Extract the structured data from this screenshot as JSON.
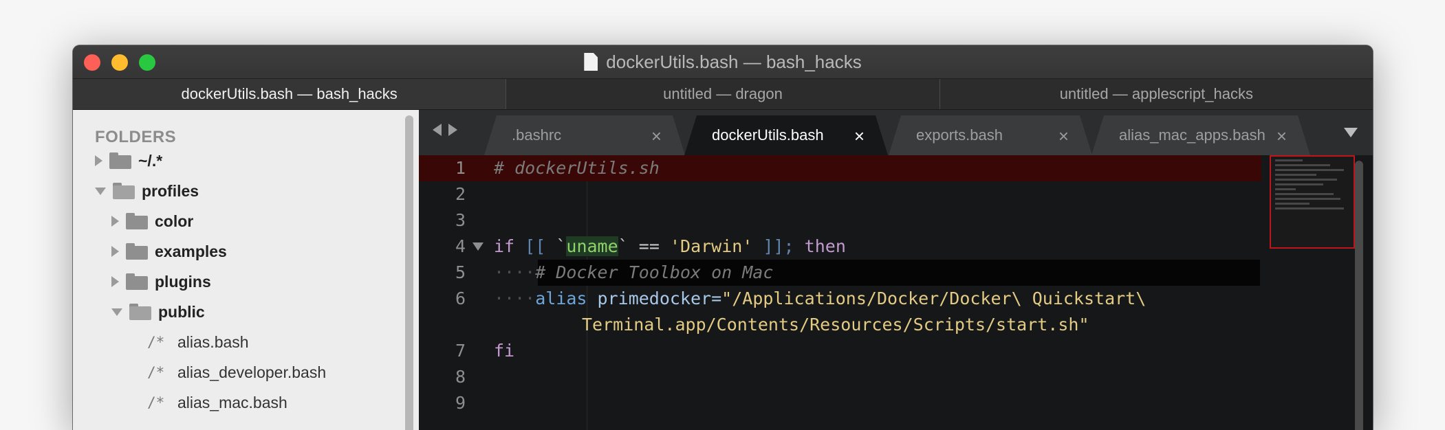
{
  "window": {
    "title": "dockerUtils.bash — bash_hacks",
    "window_tabs": [
      {
        "label": "dockerUtils.bash — bash_hacks",
        "active": true
      },
      {
        "label": "untitled — dragon",
        "active": false
      },
      {
        "label": "untitled — applescript_hacks",
        "active": false
      }
    ]
  },
  "sidebar": {
    "header": "FOLDERS",
    "folders": [
      {
        "name": "~/.*",
        "state": "collapsed"
      },
      {
        "name": "profiles",
        "state": "expanded"
      },
      {
        "name": "color",
        "state": "collapsed"
      },
      {
        "name": "examples",
        "state": "collapsed"
      },
      {
        "name": "plugins",
        "state": "collapsed"
      },
      {
        "name": "public",
        "state": "expanded"
      }
    ],
    "files": [
      {
        "glyph": "/*",
        "name": "alias.bash"
      },
      {
        "glyph": "/*",
        "name": "alias_developer.bash"
      },
      {
        "glyph": "/*",
        "name": "alias_mac.bash"
      }
    ]
  },
  "editor": {
    "file_tabs": [
      {
        "label": ".bashrc",
        "close": "×",
        "active": false
      },
      {
        "label": "dockerUtils.bash",
        "close": "×",
        "active": true
      },
      {
        "label": "exports.bash",
        "close": "×",
        "active": false
      },
      {
        "label": "alias_mac_apps.bash",
        "close": "×",
        "active": false
      }
    ],
    "line_numbers": [
      "1",
      "2",
      "3",
      "4",
      "5",
      "6",
      "7",
      "8",
      "9"
    ],
    "code": {
      "l1": "# dockerUtils.sh",
      "l4_if": "if",
      "l4_open": "[[",
      "l4_bt1": "`",
      "l4_cmd": "uname",
      "l4_bt2": "`",
      "l4_eq": "==",
      "l4_str": "'Darwin'",
      "l4_close": "]];",
      "l4_then": "then",
      "l5_dots": "····",
      "l5_comment": "# Docker Toolbox on Mac",
      "l6_dots": "····",
      "l6_alias": "alias",
      "l6_name": "primedocker=",
      "l6_str_a": "\"/Applications/Docker/Docker\\ Quickstart\\",
      "l6_str_b": "Terminal.app/Contents/Resources/Scripts/start.sh\"",
      "l7": "fi"
    },
    "colors": {
      "highlight_line": "#3a0707",
      "keyword": "#c39ad0",
      "string": "#e3cb84",
      "command": "#8fd16b",
      "comment": "#7b7b7b",
      "minimap_border": "#c0151c"
    }
  }
}
